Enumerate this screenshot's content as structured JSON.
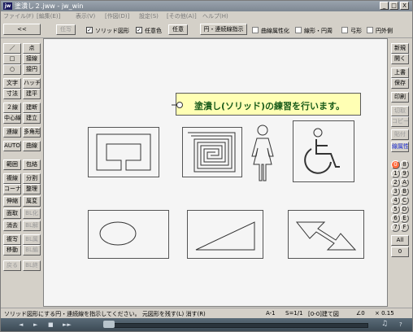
{
  "window": {
    "title": "塗潰し２.jww - jw_win",
    "icon_text": "jw",
    "min": "_",
    "max": "□",
    "close": "X"
  },
  "menu": [
    "ファイル(F)",
    "[編集(E)]",
    "表示(V)",
    "[作図(D)]",
    "設定(S)",
    "[その他(A)]",
    "ヘルプ(H)"
  ],
  "toolbar": {
    "back_btn": "<<",
    "sample_btn": "任写",
    "solid_label": "ソリッド図形",
    "anycolor_label": "任意色",
    "anycolor_btn": "任意",
    "circle_btn": "円・連続線指示",
    "curve_label": "曲線属性化",
    "polyline_label": "線形・円周",
    "arc_label": "弓形",
    "outer_label": "円外側"
  },
  "left_col1": [
    "／",
    "□",
    "○",
    "文字",
    "寸法",
    "２線",
    "中心線",
    "連線",
    "AUTO",
    "範囲",
    "複線",
    "コーナー",
    "伸縮",
    "面取",
    "消去",
    "複写",
    "移動",
    "戻る"
  ],
  "left_col2": [
    "点",
    "接線",
    "接円",
    "ハッチ",
    "建平",
    "建断",
    "建立",
    "多角形",
    "曲線",
    "包絡",
    "分割",
    "整理",
    "属変",
    "BL化",
    "BL解",
    "BL属",
    "BL編",
    "BL終"
  ],
  "right_col": [
    "新規",
    "開く",
    "上書",
    "保存",
    "印刷",
    "切取",
    "コピー",
    "貼付",
    "線属性"
  ],
  "layer_buttons": [
    [
      "0",
      "8"
    ],
    [
      "1",
      "9"
    ],
    [
      "2",
      "A"
    ],
    [
      "3",
      "B"
    ],
    [
      "4",
      "C"
    ],
    [
      "5",
      "D"
    ],
    [
      "6",
      "E"
    ],
    [
      "7",
      "F"
    ]
  ],
  "layer_all": "All",
  "layer_zero": "0",
  "callout_text": "塗潰し(ソリッド)の練習を行います。",
  "status": {
    "message": "ソリッド図形にする円・連続線を指示してください。  元図形を残す(L)  消す(R)",
    "layer": "A-1",
    "scale": "S=1/1",
    "group": "[0-0]建て図",
    "angle": "∠0",
    "zoom": "× 0.15"
  },
  "player": {
    "prev": "◄",
    "play": "►",
    "stop": "■",
    "next": "►►",
    "volume": "♫",
    "help": "?"
  }
}
